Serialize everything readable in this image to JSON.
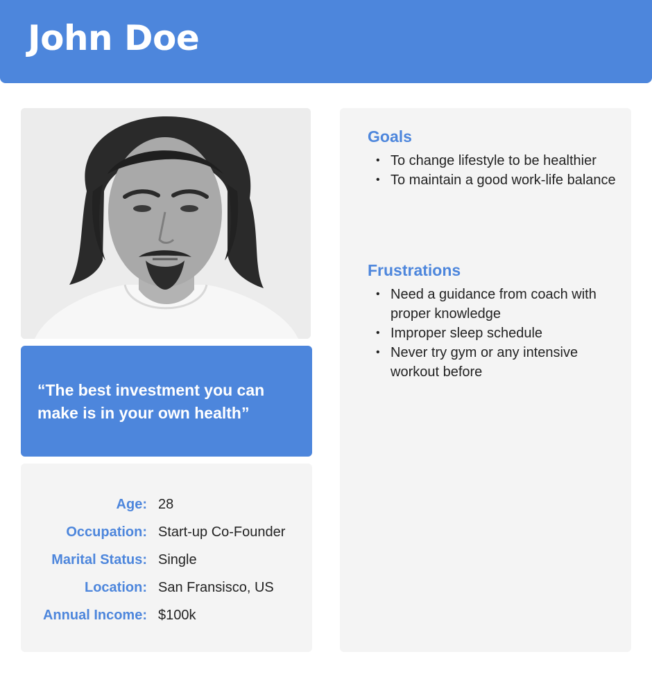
{
  "persona": {
    "name": "John Doe",
    "quote": "“The best investment you can make is in your own health”"
  },
  "details": [
    {
      "label": "Age:",
      "value": "28"
    },
    {
      "label": "Occupation:",
      "value": "Start-up Co-Founder"
    },
    {
      "label": "Marital Status:",
      "value": "Single"
    },
    {
      "label": "Location:",
      "value": "San Fransisco, US"
    },
    {
      "label": "Annual Income:",
      "value": "$100k"
    }
  ],
  "goals": {
    "title": "Goals",
    "items": [
      "To change lifestyle to be healthier",
      "To maintain a good work-life balance"
    ]
  },
  "frustrations": {
    "title": "Frustrations",
    "items": [
      "Need a guidance from coach with proper knowledge",
      "Improper sleep schedule",
      "Never try gym or any intensive workout before"
    ]
  },
  "colors": {
    "accent": "#4d86dc",
    "card_bg": "#f4f4f4",
    "text": "#222222"
  },
  "icons": {
    "bullet": "•"
  }
}
